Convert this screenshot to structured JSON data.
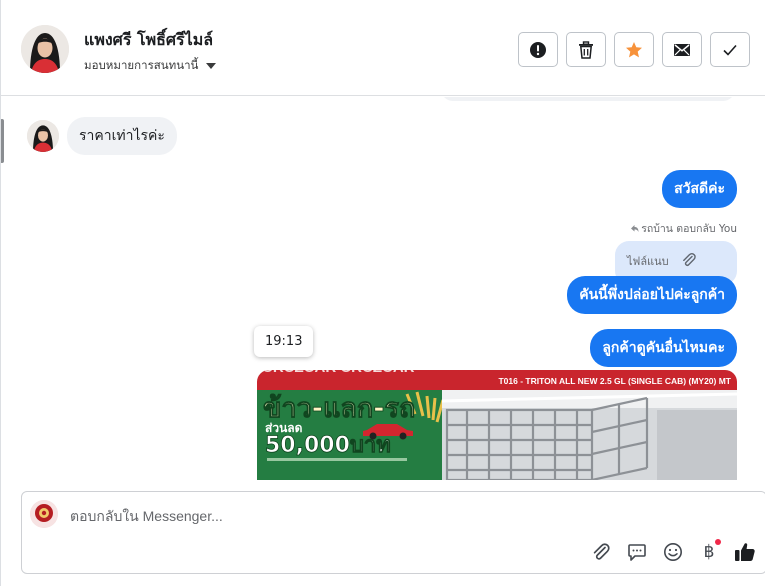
{
  "contact": {
    "name": "แพงศรี โพธิ์ศรีไมล์",
    "assign_label": "มอบหมายการสนทนานี้"
  },
  "actions": [
    {
      "name": "mark-spam-button",
      "icon": "exclamation-icon"
    },
    {
      "name": "delete-button",
      "icon": "trash-icon"
    },
    {
      "name": "star-button",
      "icon": "star-icon",
      "color": "#f7923b"
    },
    {
      "name": "mark-unread-button",
      "icon": "envelope-icon"
    },
    {
      "name": "mark-done-button",
      "icon": "checkmark-icon"
    }
  ],
  "messages": {
    "incoming_1": "ราคาเท่าไรค่ะ",
    "outgoing_1": "สวัสดีค่ะ",
    "reply_meta": "รถบ้าน ตอบกลับ You",
    "attachment_label": "ไฟล์แนบ",
    "outgoing_2": "คันนี้พึ่งปล่อยไปค่ะลูกค้า",
    "outgoing_3": "ลูกค้าดูคันอื่นไหมคะ",
    "timestamp_tooltip": "19:13"
  },
  "image_message": {
    "headline": "ข้าว-แลก-รถ",
    "discount_prefix": "ส่วนลด",
    "discount_amount": "50,000บาท",
    "model_text": "T016 - TRITON ALL NEW 2.5 GL (SINGLE CAB) (MY20) MT"
  },
  "composer": {
    "placeholder": "ตอบกลับใน Messenger..."
  },
  "colors": {
    "accent_blue": "#1877f2",
    "star_orange": "#f7923b",
    "notification_red": "#f02849"
  }
}
